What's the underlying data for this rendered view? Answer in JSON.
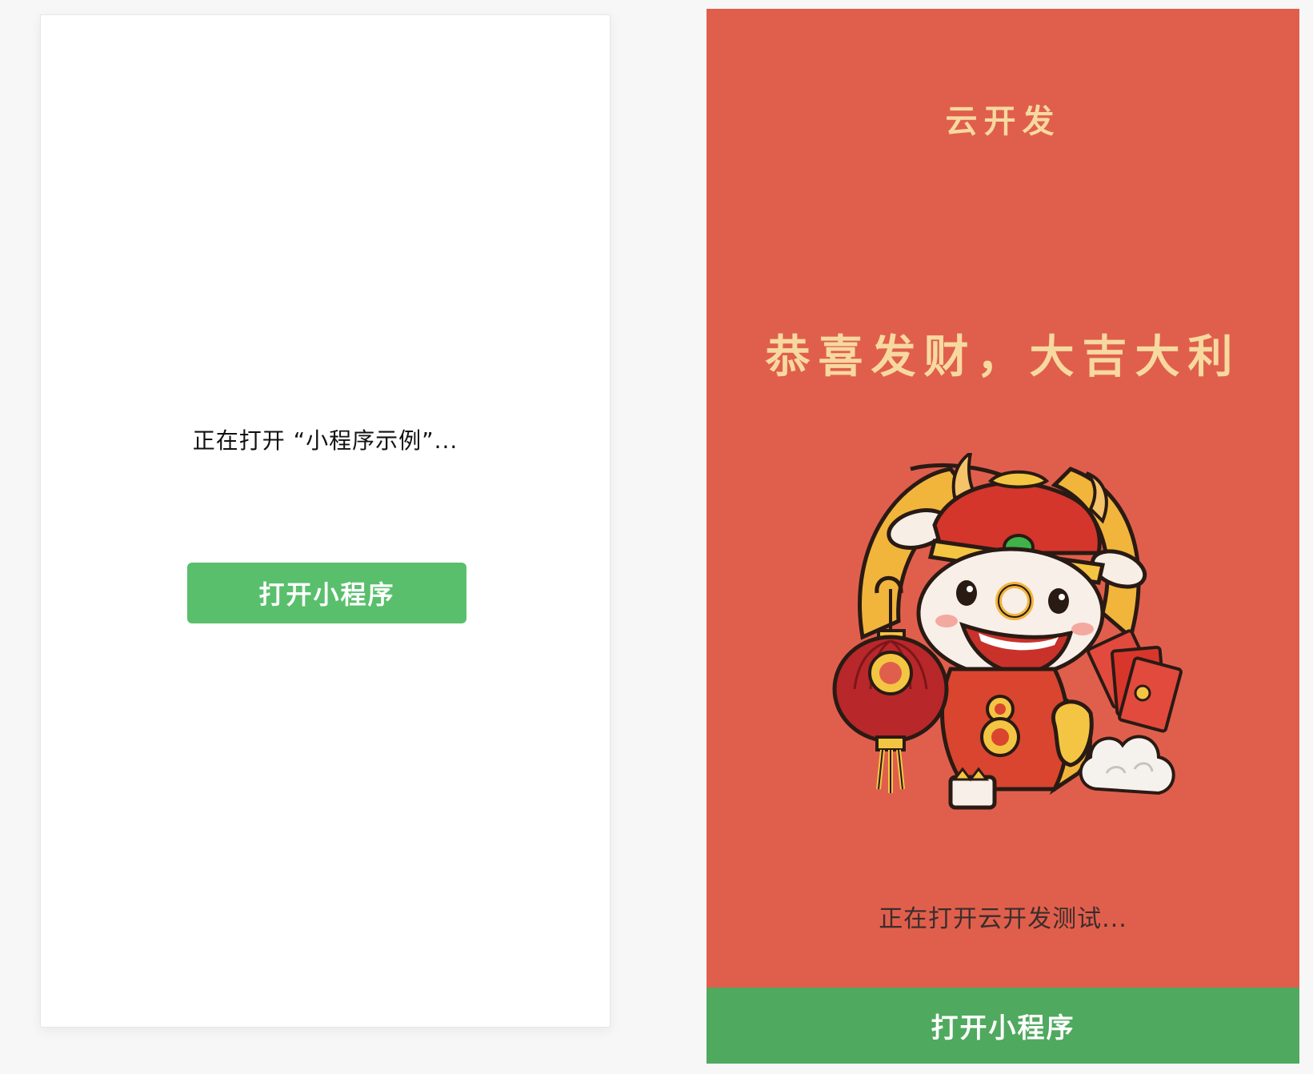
{
  "colors": {
    "page_background": "#f7f7f7",
    "left_background": "#ffffff",
    "primary_green": "#59bf6c",
    "right_background": "#e05f4c",
    "gold_text": "#f7d9a0",
    "dark_text": "#3a2d2b",
    "bottom_green": "#4fa95e"
  },
  "left": {
    "status_text": "正在打开 “小程序示例”...",
    "button_label": "打开小程序"
  },
  "right": {
    "header_title": "云开发",
    "greeting": "恭喜发财，大吉大利",
    "mascot_icon": "ox-fortune-mascot-icon",
    "status_text": "正在打开云开发测试...",
    "button_label": "打开小程序"
  }
}
